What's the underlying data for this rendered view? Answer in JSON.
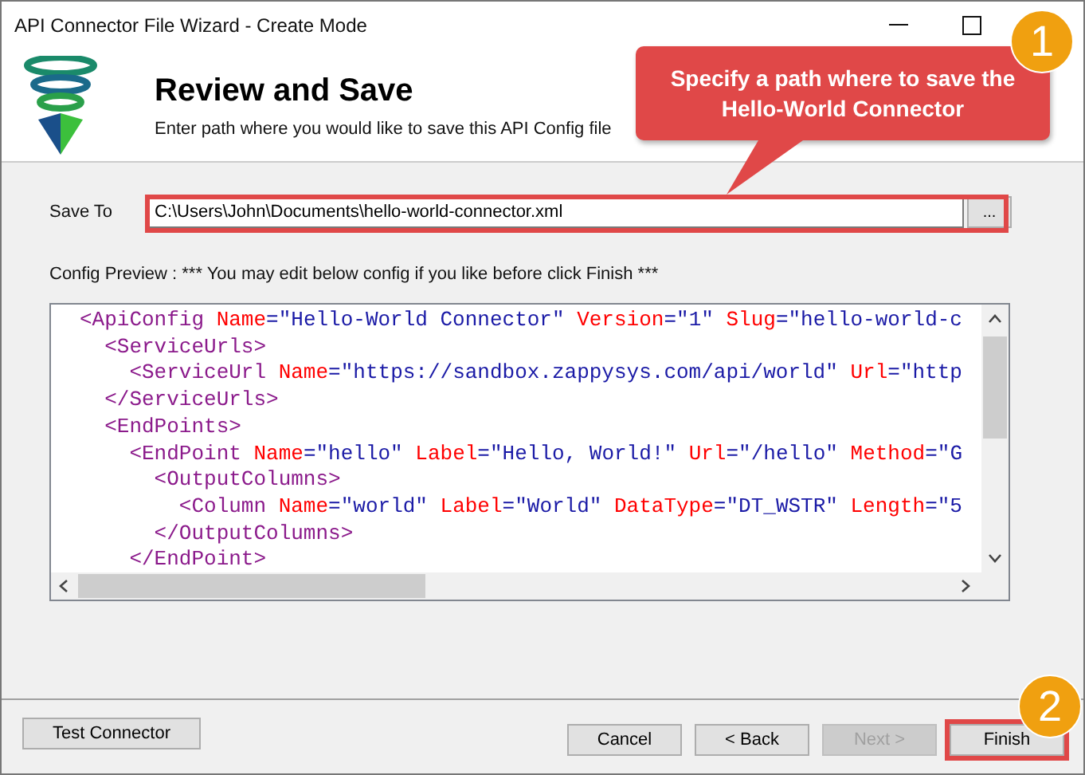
{
  "window": {
    "title": "API Connector File Wizard - Create Mode"
  },
  "header": {
    "title": "Review and Save",
    "subtitle": "Enter path where you would like to save this API Config file"
  },
  "save_to": {
    "label": "Save To",
    "value": "C:\\Users\\John\\Documents\\hello-world-connector.xml",
    "browse": "..."
  },
  "preview_label": "Config Preview : *** You may edit below config if you like before click Finish ***",
  "config_lines": [
    {
      "tokens": [
        {
          "kind": "tag",
          "text": "<ApiConfig"
        },
        {
          "kind": "attr",
          "text": " Name"
        },
        {
          "kind": "punct",
          "text": "="
        },
        {
          "kind": "value",
          "text": "\"Hello-World Connector\""
        },
        {
          "kind": "attr",
          "text": " Version"
        },
        {
          "kind": "punct",
          "text": "="
        },
        {
          "kind": "value",
          "text": "\"1\""
        },
        {
          "kind": "attr",
          "text": " Slug"
        },
        {
          "kind": "punct",
          "text": "="
        },
        {
          "kind": "value",
          "text": "\"hello-world-c"
        }
      ]
    },
    {
      "tokens": [
        {
          "kind": "tag",
          "text": "  <ServiceUrls>"
        }
      ]
    },
    {
      "tokens": [
        {
          "kind": "tag",
          "text": "    <ServiceUrl"
        },
        {
          "kind": "attr",
          "text": " Name"
        },
        {
          "kind": "punct",
          "text": "="
        },
        {
          "kind": "value",
          "text": "\"https://sandbox.zappysys.com/api/world\""
        },
        {
          "kind": "attr",
          "text": " Url"
        },
        {
          "kind": "punct",
          "text": "="
        },
        {
          "kind": "value",
          "text": "\"http"
        }
      ]
    },
    {
      "tokens": [
        {
          "kind": "tag",
          "text": "  </ServiceUrls>"
        }
      ]
    },
    {
      "tokens": [
        {
          "kind": "tag",
          "text": "  <EndPoints>"
        }
      ]
    },
    {
      "tokens": [
        {
          "kind": "tag",
          "text": "    <EndPoint"
        },
        {
          "kind": "attr",
          "text": " Name"
        },
        {
          "kind": "punct",
          "text": "="
        },
        {
          "kind": "value",
          "text": "\"hello\""
        },
        {
          "kind": "attr",
          "text": " Label"
        },
        {
          "kind": "punct",
          "text": "="
        },
        {
          "kind": "value",
          "text": "\"Hello, World!\""
        },
        {
          "kind": "attr",
          "text": " Url"
        },
        {
          "kind": "punct",
          "text": "="
        },
        {
          "kind": "value",
          "text": "\"/hello\""
        },
        {
          "kind": "attr",
          "text": " Method"
        },
        {
          "kind": "punct",
          "text": "="
        },
        {
          "kind": "value",
          "text": "\"G"
        }
      ]
    },
    {
      "tokens": [
        {
          "kind": "tag",
          "text": "      <OutputColumns>"
        }
      ]
    },
    {
      "tokens": [
        {
          "kind": "tag",
          "text": "        <Column"
        },
        {
          "kind": "attr",
          "text": " Name"
        },
        {
          "kind": "punct",
          "text": "="
        },
        {
          "kind": "value",
          "text": "\"world\""
        },
        {
          "kind": "attr",
          "text": " Label"
        },
        {
          "kind": "punct",
          "text": "="
        },
        {
          "kind": "value",
          "text": "\"World\""
        },
        {
          "kind": "attr",
          "text": " DataType"
        },
        {
          "kind": "punct",
          "text": "="
        },
        {
          "kind": "value",
          "text": "\"DT_WSTR\""
        },
        {
          "kind": "attr",
          "text": " Length"
        },
        {
          "kind": "punct",
          "text": "="
        },
        {
          "kind": "value",
          "text": "\"5"
        }
      ]
    },
    {
      "tokens": [
        {
          "kind": "tag",
          "text": "      </OutputColumns>"
        }
      ]
    },
    {
      "tokens": [
        {
          "kind": "tag",
          "text": "    </EndPoint>"
        }
      ]
    }
  ],
  "buttons": [
    {
      "label": "Test Connector",
      "disabled": false,
      "highlighted": false
    },
    {
      "label": "Cancel",
      "disabled": false,
      "highlighted": false
    },
    {
      "label": "< Back",
      "disabled": false,
      "highlighted": false
    },
    {
      "label": "Next >",
      "disabled": true,
      "highlighted": false
    },
    {
      "label": "Finish",
      "disabled": false,
      "highlighted": true
    }
  ],
  "callouts": [
    {
      "number": "1",
      "text": "Specify a path where to save the Hello-World Connector"
    },
    {
      "number": "2"
    }
  ]
}
